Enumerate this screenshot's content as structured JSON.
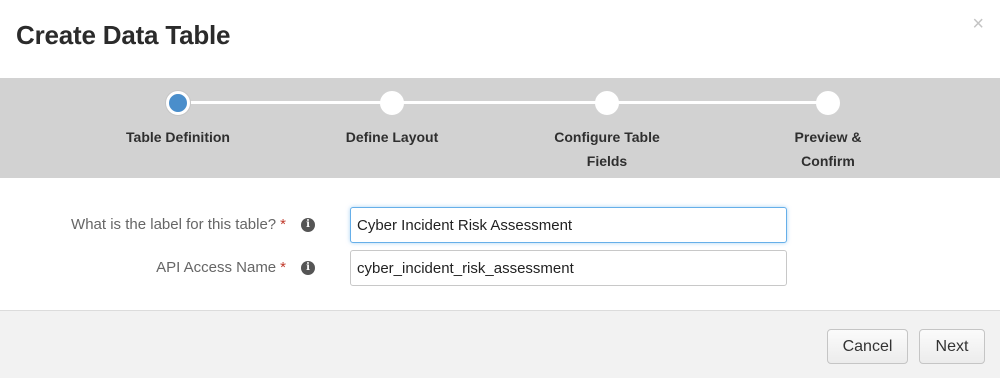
{
  "dialog": {
    "title": "Create Data Table",
    "close_glyph": "×"
  },
  "wizard": {
    "steps": [
      {
        "label": "Table Definition",
        "active": true
      },
      {
        "label": "Define Layout",
        "active": false
      },
      {
        "label": "Configure Table Fields",
        "active": false
      },
      {
        "label": "Preview & Confirm",
        "active": false
      }
    ],
    "active_color": "#4a8ecb"
  },
  "form": {
    "label_field": {
      "label": "What is the label for this table?",
      "required_mark": "*",
      "info_icon": "info-icon",
      "value": "Cyber Incident Risk Assessment"
    },
    "api_field": {
      "label": "API Access Name",
      "required_mark": "*",
      "info_icon": "info-icon",
      "value": "cyber_incident_risk_assessment"
    }
  },
  "footer": {
    "cancel_label": "Cancel",
    "next_label": "Next"
  }
}
